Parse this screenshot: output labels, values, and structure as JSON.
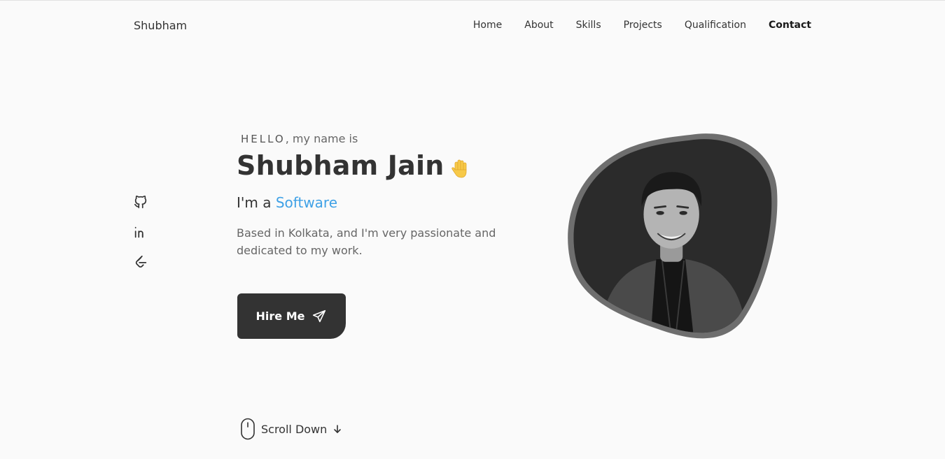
{
  "header": {
    "logo": "Shubham",
    "nav": [
      {
        "label": "Home"
      },
      {
        "label": "About"
      },
      {
        "label": "Skills"
      },
      {
        "label": "Projects"
      },
      {
        "label": "Qualification"
      },
      {
        "label": "Contact"
      }
    ]
  },
  "social": [
    {
      "icon": "github-icon"
    },
    {
      "icon": "linkedin-icon"
    },
    {
      "icon": "leetcode-icon"
    }
  ],
  "hero": {
    "greeting_hello": "HELLO",
    "greeting_rest": ", my name is",
    "name": "Shubham Jain",
    "role_prefix": "I'm a ",
    "role_highlight": "Software",
    "description": "Based in Kolkata, and I'm very passionate and dedicated to my work.",
    "cta_label": "Hire Me",
    "accent_color": "#3fa1e6",
    "button_color": "#333333"
  },
  "scroll": {
    "label": "Scroll Down"
  }
}
